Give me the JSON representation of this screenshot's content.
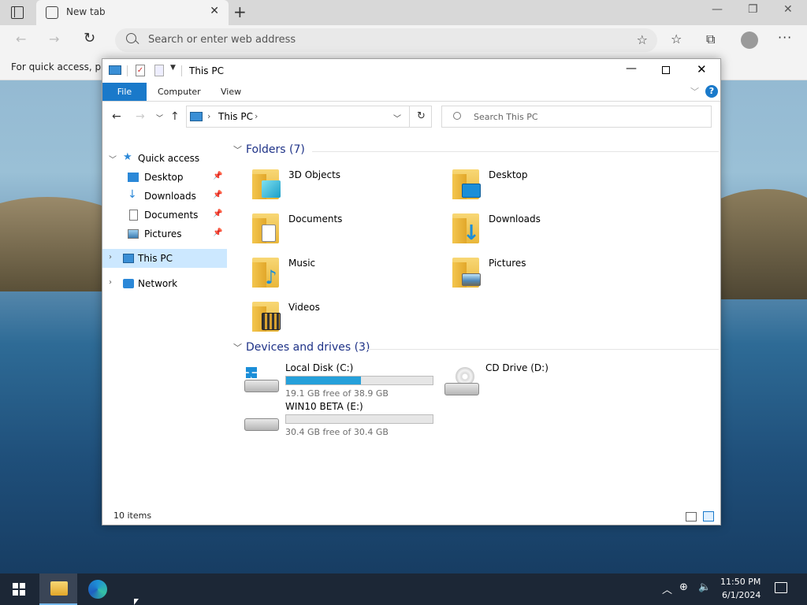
{
  "browser": {
    "tab_title": "New tab",
    "new_tab_glyph": "+",
    "address_placeholder": "Search or enter web address",
    "favorites_bar_text": "For quick access, plac",
    "icons": [
      "tab-actions-icon",
      "refresh-icon",
      "favorites-add-icon",
      "favorites-icon",
      "collections-icon",
      "profile-icon",
      "more-icon"
    ]
  },
  "explorer": {
    "title": "This PC",
    "ribbon_tabs": {
      "file": "File",
      "computer": "Computer",
      "view": "View",
      "help": "?"
    },
    "address_path": "This PC",
    "search_placeholder": "Search This PC",
    "nav": {
      "quick_access": "Quick access",
      "desktop": "Desktop",
      "downloads": "Downloads",
      "documents": "Documents",
      "pictures": "Pictures",
      "this_pc": "This PC",
      "network": "Network"
    },
    "groups": {
      "folders": "Folders (7)",
      "devices": "Devices and drives (3)"
    },
    "folders": [
      {
        "label": "3D Objects"
      },
      {
        "label": "Desktop"
      },
      {
        "label": "Documents"
      },
      {
        "label": "Downloads"
      },
      {
        "label": "Music"
      },
      {
        "label": "Pictures"
      },
      {
        "label": "Videos"
      }
    ],
    "drives": [
      {
        "label": "Local Disk (C:)",
        "free_text": "19.1 GB free of 38.9 GB",
        "used_fraction": 0.509
      },
      {
        "label": "CD Drive (D:)"
      },
      {
        "label": "WIN10 BETA (E:)",
        "free_text": "30.4 GB free of 30.4 GB",
        "used_fraction": 0.0
      }
    ],
    "status": "10 items",
    "accent_color": "#1979ca"
  },
  "taskbar": {
    "time": "11:50 PM",
    "date": "6/1/2024"
  }
}
